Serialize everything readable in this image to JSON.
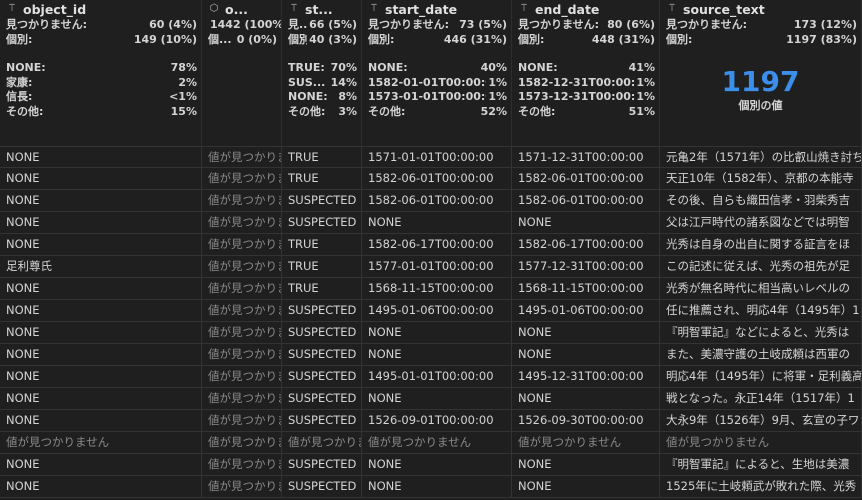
{
  "columns": [
    {
      "name": "object_id",
      "icon": "text-type-icon",
      "stats": [
        [
          "見つかりません:",
          "60 (4%)"
        ],
        [
          "個別:",
          "149 (10%)"
        ]
      ],
      "dist": [
        [
          "NONE:",
          "78%"
        ],
        [
          "家康:",
          "2%"
        ],
        [
          "信長:",
          "<1%"
        ],
        [
          "その他:",
          "15%"
        ]
      ]
    },
    {
      "name": "o...",
      "icon": "cube-icon",
      "stats": [
        [
          "見つかりません:",
          "1442 (100%)"
        ],
        [
          "個...",
          "0 (0%)"
        ]
      ],
      "dist": []
    },
    {
      "name": "st...",
      "icon": "text-type-icon",
      "stats": [
        [
          "見...",
          "66 (5%)"
        ],
        [
          "個別:",
          "40 (3%)"
        ]
      ],
      "dist": [
        [
          "TRUE:",
          "70%"
        ],
        [
          "SUS...",
          "14%"
        ],
        [
          "NONE:",
          "8%"
        ],
        [
          "その他:",
          "3%"
        ]
      ]
    },
    {
      "name": "start_date",
      "icon": "text-type-icon",
      "stats": [
        [
          "見つかりません:",
          "73 (5%)"
        ],
        [
          "個別:",
          "446 (31%)"
        ]
      ],
      "dist": [
        [
          "NONE:",
          "40%"
        ],
        [
          "1582-01-01T00:00:00:",
          "1%"
        ],
        [
          "1573-01-01T00:00:00:",
          "1%"
        ],
        [
          "その他:",
          "52%"
        ]
      ]
    },
    {
      "name": "end_date",
      "icon": "text-type-icon",
      "stats": [
        [
          "見つかりません:",
          "80 (6%)"
        ],
        [
          "個別:",
          "448 (31%)"
        ]
      ],
      "dist": [
        [
          "NONE:",
          "41%"
        ],
        [
          "1582-12-31T00:00:00:",
          "1%"
        ],
        [
          "1573-12-31T00:00:00:",
          "1%"
        ],
        [
          "その他:",
          "51%"
        ]
      ]
    },
    {
      "name": "source_text",
      "icon": "text-type-icon",
      "stats": [
        [
          "見つかりません:",
          "173 (12%)"
        ],
        [
          "個別:",
          "1197 (83%)"
        ]
      ],
      "dist": [],
      "big_number": "1197",
      "big_label": "個別の値"
    }
  ],
  "rows": [
    [
      "NONE",
      "値が見つかりません",
      "TRUE",
      "1571-01-01T00:00:00",
      "1571-12-31T00:00:00",
      "元亀2年（1571年）の比叡山焼き討ち"
    ],
    [
      "NONE",
      "値が見つかりません",
      "TRUE",
      "1582-06-01T00:00:00",
      "1582-06-01T00:00:00",
      "天正10年（1582年）、京都の本能寺"
    ],
    [
      "NONE",
      "値が見つかりません",
      "SUSPECTED",
      "1582-06-01T00:00:00",
      "1582-06-01T00:00:00",
      "その後、自らも織田信孝・羽柴秀吉"
    ],
    [
      "NONE",
      "値が見つかりません",
      "SUSPECTED",
      "NONE",
      "NONE",
      "父は江戸時代の諸系図などでは明智"
    ],
    [
      "NONE",
      "値が見つかりません",
      "TRUE",
      "1582-06-17T00:00:00",
      "1582-06-17T00:00:00",
      "光秀は自身の出自に関する証言をほ"
    ],
    [
      "足利尊氏",
      "値が見つかりません",
      "TRUE",
      "1577-01-01T00:00:00",
      "1577-12-31T00:00:00",
      "この記述に従えば、光秀の祖先が足"
    ],
    [
      "NONE",
      "値が見つかりません",
      "TRUE",
      "1568-11-15T00:00:00",
      "1568-11-15T00:00:00",
      "光秀が無名時代に相当高いレベルの"
    ],
    [
      "NONE",
      "値が見つかりません",
      "SUSPECTED",
      "1495-01-06T00:00:00",
      "1495-01-06T00:00:00",
      "任に推薦され、明応4年（1495年）1"
    ],
    [
      "NONE",
      "値が見つかりません",
      "SUSPECTED",
      "NONE",
      "NONE",
      "『明智軍記』などによると、光秀は"
    ],
    [
      "NONE",
      "値が見つかりません",
      "SUSPECTED",
      "NONE",
      "NONE",
      "また、美濃守護の土岐成頼は西軍の"
    ],
    [
      "NONE",
      "値が見つかりません",
      "SUSPECTED",
      "1495-01-01T00:00:00",
      "1495-12-31T00:00:00",
      "明応4年（1495年）に将軍・足利義高"
    ],
    [
      "NONE",
      "値が見つかりません",
      "SUSPECTED",
      "NONE",
      "NONE",
      "戦となった。永正14年（1517年）1"
    ],
    [
      "NONE",
      "値が見つかりません",
      "SUSPECTED",
      "1526-09-01T00:00:00",
      "1526-09-30T00:00:00",
      "大永9年（1526年）9月、玄宣の子ワ"
    ],
    [
      "値が見つかりません",
      "値が見つかりません",
      "値が見つかりません",
      "値が見つかりません",
      "値が見つかりません",
      "値が見つかりません"
    ],
    [
      "NONE",
      "値が見つかりません",
      "SUSPECTED",
      "NONE",
      "NONE",
      "『明智軍記』によると、生地は美濃"
    ],
    [
      "NONE",
      "値が見つかりません",
      "SUSPECTED",
      "NONE",
      "NONE",
      "1525年に土岐頼武が敗れた際、光秀"
    ]
  ],
  "missing_label": "値が見つかりません"
}
